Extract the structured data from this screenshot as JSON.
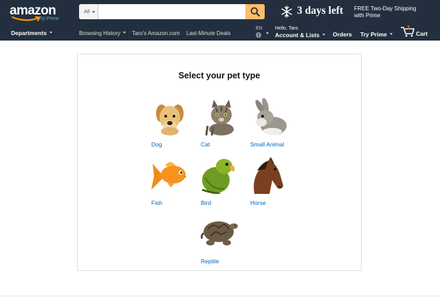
{
  "nav": {
    "logo_text": "amazon",
    "logo_subtext": "Try Prime",
    "search": {
      "department": "All",
      "placeholder": "",
      "value": ""
    },
    "promo_text": "3 days left",
    "shipping_line1": "FREE Two-Day Shipping",
    "shipping_line2": "with Prime",
    "departments_label": "Departments",
    "links": [
      "Browsing History",
      "Taro's Amazon.com",
      "Last-Minute Deals"
    ],
    "language": "EN",
    "account_greeting": "Hello, Taro",
    "account_label": "Account & Lists",
    "orders_label": "Orders",
    "prime_label": "Try Prime",
    "cart_count": "1",
    "cart_label": "Cart"
  },
  "main": {
    "title": "Select your pet type",
    "pets": [
      {
        "label": "Dog",
        "icon": "dog-image"
      },
      {
        "label": "Cat",
        "icon": "cat-image"
      },
      {
        "label": "Small Animal",
        "icon": "rabbit-image"
      },
      {
        "label": "Fish",
        "icon": "goldfish-image"
      },
      {
        "label": "Bird",
        "icon": "parrot-image"
      },
      {
        "label": "Horse",
        "icon": "horse-image"
      },
      {
        "label": "Reptile",
        "icon": "turtle-image"
      }
    ]
  },
  "colors": {
    "nav_bg": "#232f3e",
    "search_button": "#febd69",
    "link_blue": "#0066c0",
    "cart_count": "#f08804"
  }
}
